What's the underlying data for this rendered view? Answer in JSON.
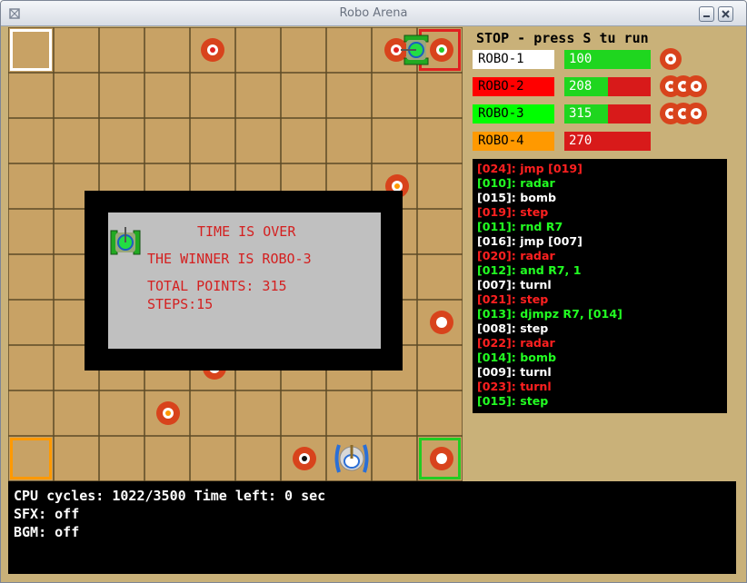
{
  "window": {
    "title": "Robo Arena"
  },
  "status": {
    "message": "STOP - press S tu run"
  },
  "robots": [
    {
      "name": "ROBO-1",
      "points": "100",
      "health_fraction": 1.0,
      "name_bg": "#ffffff",
      "name_fg": "#000000",
      "lives": 1
    },
    {
      "name": "ROBO-2",
      "points": "208",
      "health_fraction": 0.5,
      "name_bg": "#ff0000",
      "name_fg": "#000000",
      "lives": 3
    },
    {
      "name": "ROBO-3",
      "points": "315",
      "health_fraction": 0.5,
      "name_bg": "#00ff00",
      "name_fg": "#000000",
      "lives": 3
    },
    {
      "name": "ROBO-4",
      "points": "270",
      "health_fraction": 0.0,
      "name_bg": "#ff9900",
      "name_fg": "#000000",
      "lives": 0
    }
  ],
  "log": [
    {
      "addr": "[024]:",
      "instr": " jmp [019]",
      "color": "red"
    },
    {
      "addr": "[010]:",
      "instr": " radar",
      "color": "green"
    },
    {
      "addr": "[015]:",
      "instr": " bomb",
      "color": "white"
    },
    {
      "addr": "[019]:",
      "instr": " step",
      "color": "red"
    },
    {
      "addr": "[011]:",
      "instr": " rnd R7",
      "color": "green"
    },
    {
      "addr": "[016]:",
      "instr": " jmp [007]",
      "color": "white"
    },
    {
      "addr": "[020]:",
      "instr": " radar",
      "color": "red"
    },
    {
      "addr": "[012]:",
      "instr": " and R7, 1",
      "color": "green"
    },
    {
      "addr": "[007]:",
      "instr": " turnl",
      "color": "white"
    },
    {
      "addr": "[021]:",
      "instr": " step",
      "color": "red"
    },
    {
      "addr": "[013]:",
      "instr": " djmpz R7, [014]",
      "color": "green"
    },
    {
      "addr": "[008]:",
      "instr": " step",
      "color": "white"
    },
    {
      "addr": "[022]:",
      "instr": " radar",
      "color": "red"
    },
    {
      "addr": "[014]:",
      "instr": " bomb",
      "color": "green"
    },
    {
      "addr": "[009]:",
      "instr": " turnl",
      "color": "white"
    },
    {
      "addr": "[023]:",
      "instr": " turnl",
      "color": "red"
    },
    {
      "addr": "[015]:",
      "instr": " step",
      "color": "green"
    }
  ],
  "dialog": {
    "line1": "TIME IS OVER",
    "line2": "THE WINNER IS ROBO-3",
    "line3": "TOTAL POINTS: 315",
    "line4": "STEPS:15"
  },
  "console": {
    "cpu": "CPU cycles: 1022/3500 Time left: 0 sec",
    "sfx": "SFX: off",
    "bgm": "BGM: off"
  },
  "arena": {
    "rows": 10,
    "cols": 10,
    "base_colors": [
      "#ffffff",
      "#e02020",
      "#ff9900",
      "#22cc22"
    ]
  },
  "colors": {
    "red": "#ff2020",
    "green": "#22ff22",
    "white": "#ffffff",
    "arena_tile": "#c8a265",
    "panel_bg": "#c9b179"
  },
  "icons": [
    "window-app-icon",
    "minimize-icon",
    "close-icon",
    "mine-icon",
    "tank-icon",
    "life-icon"
  ]
}
